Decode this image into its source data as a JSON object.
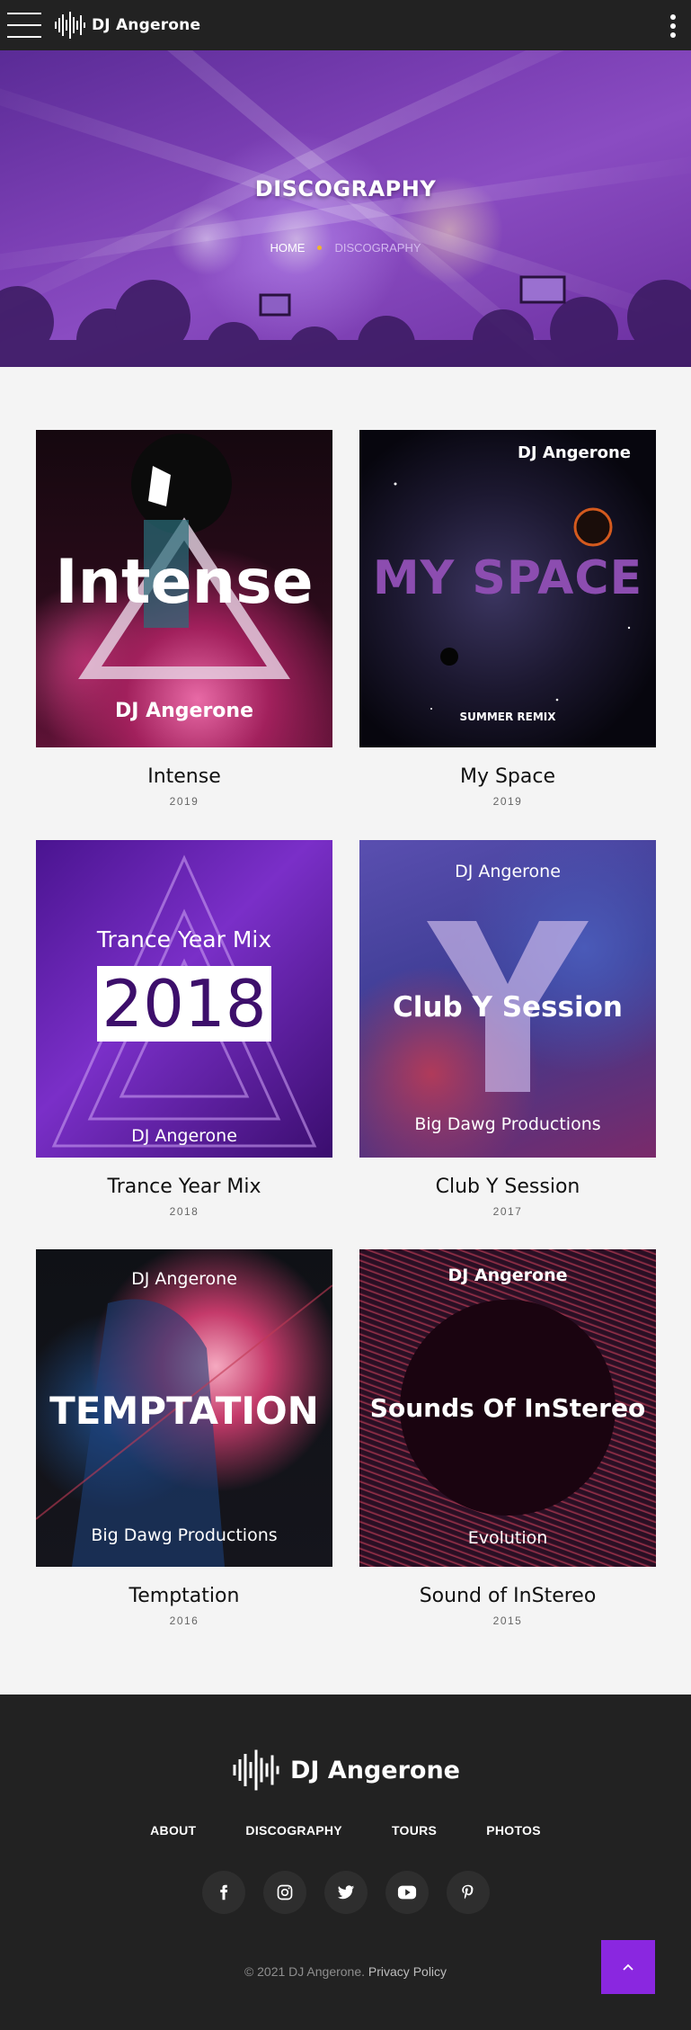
{
  "header": {
    "brand": "DJ Angerone"
  },
  "hero": {
    "title": "DISCOGRAPHY",
    "breadcrumb_home": "HOME",
    "breadcrumb_current": "DISCOGRAPHY"
  },
  "albums": [
    {
      "title": "Intense",
      "year": "2019",
      "cover_lines": [
        "Intense",
        "DJ Angerone"
      ]
    },
    {
      "title": "My Space",
      "year": "2019",
      "cover_lines": [
        "DJ Angerone",
        "MY SPACE",
        "SUMMER REMIX"
      ]
    },
    {
      "title": "Trance Year Mix",
      "year": "2018",
      "cover_lines": [
        "Trance Year Mix",
        "2018",
        "DJ Angerone"
      ]
    },
    {
      "title": "Club Y Session",
      "year": "2017",
      "cover_lines": [
        "DJ Angerone",
        "Club Y Session",
        "Big Dawg Productions"
      ]
    },
    {
      "title": "Temptation",
      "year": "2016",
      "cover_lines": [
        "DJ Angerone",
        "TEMPTATION",
        "Big Dawg Productions"
      ]
    },
    {
      "title": "Sound of InStereo",
      "year": "2015",
      "cover_lines": [
        "DJ Angerone",
        "Sounds Of InStereo",
        "Evolution"
      ]
    }
  ],
  "footer": {
    "brand": "DJ Angerone",
    "nav": [
      "ABOUT",
      "DISCOGRAPHY",
      "TOURS",
      "PHOTOS"
    ],
    "social": [
      "facebook-icon",
      "instagram-icon",
      "twitter-icon",
      "youtube-icon",
      "pinterest-icon"
    ],
    "copyright_prefix": "©  2021 DJ Angerone.",
    "privacy": "Privacy Policy"
  },
  "colors": {
    "accent": "#8a27e0",
    "dark": "#222222",
    "breadcrumb_dot": "#f1b52a"
  }
}
